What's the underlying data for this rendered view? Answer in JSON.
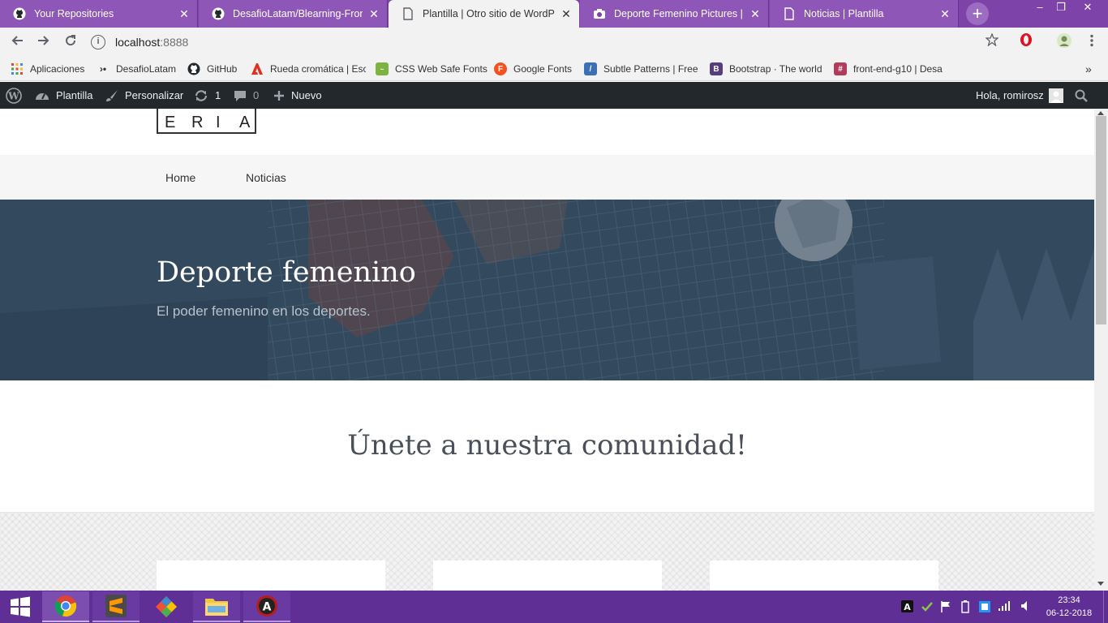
{
  "browser": {
    "tabs": [
      {
        "title": "Your Repositories",
        "icon": "github-icon",
        "active": false
      },
      {
        "title": "DesafioLatam/Blearning-Fronten",
        "icon": "github-icon",
        "active": false
      },
      {
        "title": "Plantilla | Otro sitio de WordPres",
        "icon": "page-icon",
        "active": true
      },
      {
        "title": "Deporte Femenino Pictures | Do",
        "icon": "camera-icon",
        "active": false
      },
      {
        "title": "Noticias | Plantilla",
        "icon": "page-icon",
        "active": false
      }
    ],
    "new_tab_label": "+",
    "window_controls": {
      "minimize": "–",
      "restore": "❐",
      "close": "✕"
    },
    "url": {
      "host": "localhost",
      "port": ":8888"
    },
    "bookmarks": [
      {
        "label": "Aplicaciones",
        "icon": "apps-icon",
        "color": "#e8453c"
      },
      {
        "label": "DesafioLatam",
        "icon": "desafio-icon",
        "color": "#333333"
      },
      {
        "label": "GitHub",
        "icon": "github-icon",
        "color": "#24292e"
      },
      {
        "label": "Rueda cromática | Esc",
        "icon": "adobe-icon",
        "color": "#e0301e"
      },
      {
        "label": "CSS Web Safe Fonts",
        "icon": "cssfont-icon",
        "color": "#7cb342"
      },
      {
        "label": "Google Fonts",
        "icon": "googlefonts-icon",
        "color": "#f4511e"
      },
      {
        "label": "Subtle Patterns | Free",
        "icon": "subtle-icon",
        "color": "#3b6fb6"
      },
      {
        "label": "Bootstrap · The world",
        "icon": "bootstrap-icon",
        "color": "#563d7c"
      },
      {
        "label": "front-end-g10 | Desa",
        "icon": "slack-icon",
        "color": "#b23b5c"
      }
    ],
    "more_bookmarks": "»"
  },
  "adminbar": {
    "site_name": "Plantilla",
    "customize": "Personalizar",
    "updates_count": "1",
    "comments_count": "0",
    "new_label": "Nuevo",
    "greeting": "Hola, romirosz"
  },
  "site": {
    "logo_letters": [
      "E",
      "R",
      "I",
      "A"
    ],
    "nav": [
      "Home",
      "Noticias"
    ],
    "hero_title": "Deporte femenino",
    "hero_subtitle": "El poder femenino en los deportes.",
    "section_title": "Únete a nuestra comunidad!"
  },
  "taskbar": {
    "apps": [
      {
        "name": "Google Chrome",
        "icon": "chrome-icon",
        "state": "active"
      },
      {
        "name": "Sublime Text",
        "icon": "sublime-icon",
        "state": "open"
      },
      {
        "name": "Git",
        "icon": "git-icon",
        "state": "pinned"
      },
      {
        "name": "File Explorer",
        "icon": "explorer-icon",
        "state": "open"
      },
      {
        "name": "App",
        "icon": "app-a-icon",
        "state": "open"
      }
    ],
    "time": "23:34",
    "date": "06-12-2018"
  },
  "colors": {
    "tabstrip": "#7e43a8",
    "adminbar": "#23282d",
    "hero_overlay": "#2e4358",
    "taskbar": "#5f2f96"
  }
}
